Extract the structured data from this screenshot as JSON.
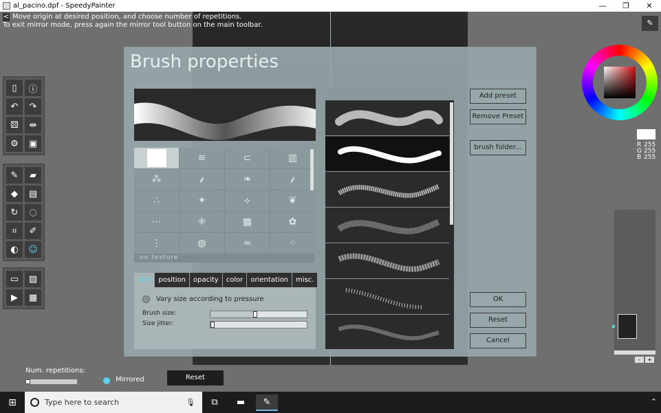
{
  "window": {
    "title": "al_pacino.dpf - SpeedyPainter",
    "minimize": "—",
    "maximize": "❐",
    "close": "✕"
  },
  "hint": {
    "back": "<",
    "line1": "Move origin at desired position, and choose number of repetitions.",
    "line2": "To exit mirror mode, press again the mirror tool button on the main toolbar."
  },
  "dialog": {
    "title": "Brush properties",
    "no_texture": "no texture",
    "tabs": [
      "size",
      "position",
      "opacity",
      "color",
      "orientation",
      "misc."
    ],
    "active_tab": "size",
    "size_panel": {
      "pressure_label": "Vary size according to pressure",
      "brush_size_label": "Brush size:",
      "brush_size_value": 0.46,
      "size_jitter_label": "Size jitter:",
      "size_jitter_value": 0.0
    },
    "buttons": {
      "add_preset": "Add preset",
      "remove_preset": "Remove Preset",
      "brush_folder": "brush folder...",
      "ok": "OK",
      "reset": "Reset",
      "cancel": "Cancel"
    }
  },
  "color": {
    "r_label": "R",
    "r": "255",
    "g_label": "G",
    "g": "255",
    "b_label": "B",
    "b": "255",
    "current": "#ffffff"
  },
  "layers": {
    "add": "+",
    "remove": "-"
  },
  "bottombar": {
    "repetitions_label": "Num. repetitions:",
    "mirrored_label": "Mirrored",
    "reset_label": "Reset"
  },
  "taskbar": {
    "search_placeholder": "Type here to search"
  }
}
